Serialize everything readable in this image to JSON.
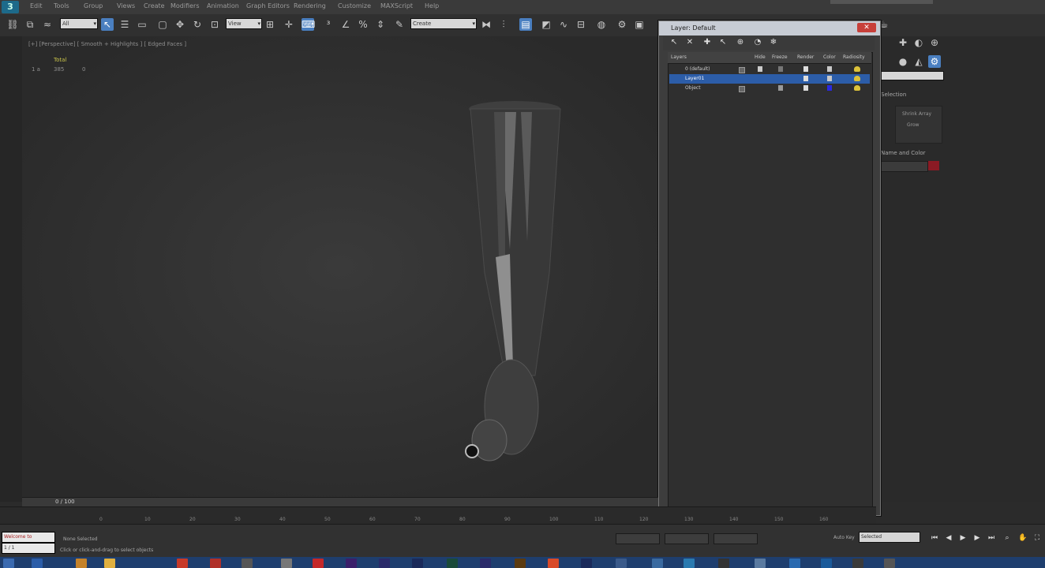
{
  "menubar": {
    "items": [
      "Edit",
      "Tools",
      "Group",
      "Views",
      "Create",
      "Modifiers",
      "Animation",
      "Graph Editors",
      "Rendering",
      "Customize",
      "MAXScript",
      "Help"
    ]
  },
  "toolbar": {
    "selection_filter": "All",
    "reference_coord": "View",
    "named_selection": "Create"
  },
  "viewport": {
    "label": "[+] [Perspective] [ Smooth + Highlights ] [ Edged Faces ]",
    "stats_label": "Total",
    "stats_line1": "1 a",
    "stats_line2": "385",
    "stats_line3": "0"
  },
  "layer_dialog": {
    "title": "Layer: Default",
    "columns": {
      "layers": "Layers",
      "hide": "Hide",
      "freeze": "Freeze",
      "render": "Render",
      "color": "Color",
      "radiosity": "Radiosity"
    },
    "rows": [
      {
        "name": "0 (default)",
        "selected": false,
        "color": "#c9c9c9"
      },
      {
        "name": "Layer01",
        "selected": true,
        "color": "#c9c9c9"
      },
      {
        "name": "Object",
        "selected": false,
        "color": "#2a2ae0"
      }
    ]
  },
  "command_panel": {
    "section1": "Selection",
    "text1": "Shrink Array",
    "text2": "Grow",
    "section2": "Name and Color",
    "object_color": "#8b1a24"
  },
  "timeline": {
    "frame_label": "0 / 100",
    "ticks": [
      "0",
      "10",
      "20",
      "30",
      "40",
      "50",
      "60",
      "70",
      "80",
      "90",
      "100",
      "110",
      "120",
      "130",
      "140",
      "150",
      "160"
    ]
  },
  "status": {
    "maxscript": "Welcome to MAXScript.",
    "maxscript2": "1 / 1",
    "selection": "None Selected",
    "hint": "Click or click-and-drag to select objects",
    "autokey_label": "Auto Key",
    "selection_mode": "Selected"
  },
  "colors": {
    "accent": "#4a7fc0",
    "taskbar": "#1e3e6e",
    "dialog_title": "#c7ccd4",
    "close": "#c7403a"
  }
}
